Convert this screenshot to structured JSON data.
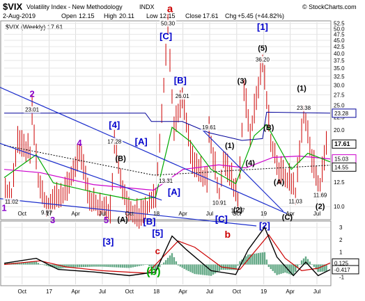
{
  "header": {
    "symbol": "$VIX",
    "name": "Volatility Index - New Methodology",
    "exchange": "INDX",
    "date": "2-Aug-2019",
    "open_label": "Open",
    "open": "12.15",
    "high_label": "High",
    "high": "20.11",
    "low_label": "Low",
    "low": "12.15",
    "close_label": "Close",
    "close": "17.61",
    "chg_label": "Chg",
    "chg": "+5.45 (+44.82%)",
    "copyright": "© StockCharts.com"
  },
  "legend_text": "$VIX (Weekly) 17.61",
  "colors": {
    "price_bar": "#cc0000",
    "trendline": "#1a2ccc",
    "upper_band": "#000099",
    "ma_short": "#00aa00",
    "ma_long": "#cc00cc",
    "dotted_line": "#000000",
    "wave_blue": "#0000cc",
    "wave_purple": "#8800cc",
    "wave_red": "#cc0000",
    "wave_green": "#00aa00",
    "hist": "#66aa88",
    "osc_black": "#000000",
    "osc_red": "#cc0000"
  },
  "chart_data": [
    {
      "type": "ohlc",
      "scale": "log",
      "ylim": [
        9,
        53
      ],
      "y_ticks": [
        "52.5",
        "50.0",
        "47.5",
        "45.0",
        "42.5",
        "40.0",
        "37.5",
        "35.0",
        "32.5",
        "30.0",
        "27.5",
        "25.0",
        "22.5",
        "20.0",
        "17.5",
        "15.0",
        "12.5",
        "10.0"
      ],
      "x_tick_labels": [
        "Oct",
        "17",
        "Apr",
        "Jul",
        "Oct",
        "18",
        "Apr",
        "Jul",
        "Oct",
        "19",
        "Apr",
        "Jul"
      ],
      "x_tick_dates": [
        "2016-10-01",
        "2017-01-01",
        "2017-04-01",
        "2017-07-01",
        "2017-10-01",
        "2018-01-01",
        "2018-04-01",
        "2018-07-01",
        "2018-10-01",
        "2019-01-01",
        "2019-04-01",
        "2019-07-01"
      ],
      "x_range": [
        "2016-08-01",
        "2019-08-15"
      ],
      "price_key_points": [
        {
          "date": "2016-08-05",
          "value": 11.5
        },
        {
          "date": "2016-08-26",
          "value": 11.02
        },
        {
          "date": "2016-09-16",
          "value": 18.0
        },
        {
          "date": "2016-10-28",
          "value": 16.0
        },
        {
          "date": "2016-11-04",
          "value": 23.01
        },
        {
          "date": "2016-11-25",
          "value": 12.5
        },
        {
          "date": "2016-12-23",
          "value": 9.97
        },
        {
          "date": "2017-03-03",
          "value": 11.5
        },
        {
          "date": "2017-04-14",
          "value": 16.0
        },
        {
          "date": "2017-05-19",
          "value": 10.5
        },
        {
          "date": "2017-07-28",
          "value": 9.4
        },
        {
          "date": "2017-08-11",
          "value": 17.28
        },
        {
          "date": "2017-09-22",
          "value": 9.8
        },
        {
          "date": "2017-11-03",
          "value": 9.1
        },
        {
          "date": "2017-12-29",
          "value": 10.8
        },
        {
          "date": "2018-02-09",
          "value": 50.3
        },
        {
          "date": "2018-03-02",
          "value": 19.6
        },
        {
          "date": "2018-03-30",
          "value": 26.01
        },
        {
          "date": "2018-05-04",
          "value": 14.5
        },
        {
          "date": "2018-06-22",
          "value": 12.5
        },
        {
          "date": "2018-06-29",
          "value": 19.61
        },
        {
          "date": "2018-08-03",
          "value": 10.91
        },
        {
          "date": "2018-08-17",
          "value": 15.0
        },
        {
          "date": "2018-09-28",
          "value": 11.5
        },
        {
          "date": "2018-10-05",
          "value": 10.17
        },
        {
          "date": "2018-10-26",
          "value": 28.0
        },
        {
          "date": "2018-11-16",
          "value": 19.0
        },
        {
          "date": "2018-12-28",
          "value": 36.2
        },
        {
          "date": "2019-01-25",
          "value": 18.0
        },
        {
          "date": "2019-02-22",
          "value": 13.5
        },
        {
          "date": "2019-04-12",
          "value": 12.0
        },
        {
          "date": "2019-04-19",
          "value": 11.03
        },
        {
          "date": "2019-05-17",
          "value": 23.38
        },
        {
          "date": "2019-06-14",
          "value": 15.0
        },
        {
          "date": "2019-07-12",
          "value": 11.69
        },
        {
          "date": "2019-08-02",
          "value": 17.61
        }
      ],
      "price_labels": [
        {
          "text": "11.02",
          "date": "2016-08-26",
          "value": 11.02,
          "pos": "below"
        },
        {
          "text": "23.01",
          "date": "2016-11-04",
          "value": 23.01,
          "pos": "above"
        },
        {
          "text": "9.97",
          "date": "2016-12-23",
          "value": 9.97,
          "pos": "below"
        },
        {
          "text": "17.28",
          "date": "2017-08-11",
          "value": 17.28,
          "pos": "above"
        },
        {
          "text": "50.30",
          "date": "2018-02-09",
          "value": 50.3,
          "pos": "above"
        },
        {
          "text": "26.01",
          "date": "2018-03-30",
          "value": 26.01,
          "pos": "above"
        },
        {
          "text": "13.31",
          "date": "2018-02-02",
          "value": 13.31,
          "pos": "below"
        },
        {
          "text": "19.61",
          "date": "2018-06-29",
          "value": 19.61,
          "pos": "above"
        },
        {
          "text": "10.91",
          "date": "2018-08-03",
          "value": 10.91,
          "pos": "below"
        },
        {
          "text": "10.17",
          "date": "2018-10-05",
          "value": 10.17,
          "pos": "below"
        },
        {
          "text": "36.20",
          "date": "2018-12-28",
          "value": 36.2,
          "pos": "above"
        },
        {
          "text": "23.38",
          "date": "2019-05-17",
          "value": 23.38,
          "pos": "above"
        },
        {
          "text": "11.03",
          "date": "2019-04-19",
          "value": 11.03,
          "pos": "below"
        },
        {
          "text": "11.69",
          "date": "2019-07-12",
          "value": 11.69,
          "pos": "below"
        }
      ],
      "right_value_tags": [
        {
          "text": "23.28",
          "value": 23.28,
          "color": "#000099"
        },
        {
          "text": "17.61",
          "value": 17.61,
          "color": "#000000",
          "bold": true
        },
        {
          "text": "15.03",
          "value": 15.4,
          "color": "#cc00cc"
        },
        {
          "text": "14.55",
          "value": 14.3,
          "color": "#000000"
        }
      ],
      "upper_band": [
        {
          "date": "2016-08-01",
          "value": 23.3
        },
        {
          "date": "2017-11-24",
          "value": 23.3
        },
        {
          "date": "2017-12-15",
          "value": 21.6
        },
        {
          "date": "2018-03-30",
          "value": 21.6
        },
        {
          "date": "2018-06-29",
          "value": 19.5
        },
        {
          "date": "2018-10-19",
          "value": 18.2
        },
        {
          "date": "2018-12-28",
          "value": 18.5
        },
        {
          "date": "2019-01-11",
          "value": 23.5
        },
        {
          "date": "2019-08-15",
          "value": 23.28
        }
      ],
      "ma_long": [
        {
          "date": "2016-08-01",
          "value": 14.0
        },
        {
          "date": "2016-12-01",
          "value": 13.6
        },
        {
          "date": "2017-06-01",
          "value": 12.2
        },
        {
          "date": "2017-12-22",
          "value": 11.6
        },
        {
          "date": "2018-04-01",
          "value": 14.0
        },
        {
          "date": "2018-08-01",
          "value": 14.6
        },
        {
          "date": "2018-11-01",
          "value": 14.2
        },
        {
          "date": "2019-02-01",
          "value": 15.6
        },
        {
          "date": "2019-05-01",
          "value": 15.8
        },
        {
          "date": "2019-08-15",
          "value": 15.4
        }
      ],
      "ma_short": [
        {
          "date": "2016-08-01",
          "value": 13.0
        },
        {
          "date": "2016-11-18",
          "value": 16.0
        },
        {
          "date": "2017-01-15",
          "value": 12.4
        },
        {
          "date": "2017-06-01",
          "value": 11.4
        },
        {
          "date": "2017-10-20",
          "value": 10.6
        },
        {
          "date": "2017-12-29",
          "value": 10.9
        },
        {
          "date": "2018-02-23",
          "value": 20.5
        },
        {
          "date": "2018-04-27",
          "value": 18.0
        },
        {
          "date": "2018-07-06",
          "value": 14.0
        },
        {
          "date": "2018-09-28",
          "value": 12.3
        },
        {
          "date": "2018-11-30",
          "value": 19.0
        },
        {
          "date": "2019-01-11",
          "value": 21.0
        },
        {
          "date": "2019-04-05",
          "value": 14.0
        },
        {
          "date": "2019-05-31",
          "value": 16.2
        },
        {
          "date": "2019-08-15",
          "value": 15.0
        }
      ],
      "dotted_line": [
        {
          "date": "2016-08-01",
          "value": 17.4
        },
        {
          "date": "2017-12-22",
          "value": 13.3
        },
        {
          "date": "2018-06-01",
          "value": 13.6
        },
        {
          "date": "2018-10-01",
          "value": 13.9
        },
        {
          "date": "2019-08-15",
          "value": 14.55
        }
      ],
      "trendlines": [
        {
          "from": {
            "date": "2016-07-01",
            "value": 30.0
          },
          "to": {
            "date": "2019-03-20",
            "value": 9.4
          }
        },
        {
          "from": {
            "date": "2016-07-01",
            "value": 18.0
          },
          "to": {
            "date": "2018-01-19",
            "value": 10.6
          }
        },
        {
          "from": {
            "date": "2018-06-01",
            "value": 20.3
          },
          "to": {
            "date": "2019-03-08",
            "value": 9.6
          }
        },
        {
          "from": {
            "date": "2016-07-01",
            "value": 10.8
          },
          "to": {
            "date": "2018-12-07",
            "value": 8.4
          }
        }
      ],
      "wave_labels": [
        {
          "text": "a",
          "date": "2018-02-16",
          "value": 58.0,
          "color": "#cc0000",
          "size": 15
        },
        {
          "text": "[C]",
          "date": "2018-02-02",
          "value": 45.5,
          "color": "#0000cc",
          "size": 13
        },
        {
          "text": "[1]",
          "date": "2018-12-28",
          "value": 49.5,
          "color": "#0000cc",
          "size": 13
        },
        {
          "text": "(5)",
          "date": "2018-12-28",
          "value": 41.0,
          "color": "#000000",
          "size": 11
        },
        {
          "text": "(3)",
          "date": "2018-10-19",
          "value": 30.5,
          "color": "#000000",
          "size": 11
        },
        {
          "text": "(1)",
          "date": "2019-05-10",
          "value": 28.5,
          "color": "#000000",
          "size": 11
        },
        {
          "text": "[B]",
          "date": "2018-03-23",
          "value": 30.5,
          "color": "#0000cc",
          "size": 13
        },
        {
          "text": "2",
          "date": "2016-11-04",
          "value": 27.0,
          "color": "#8800cc",
          "size": 13
        },
        {
          "text": "[4]",
          "date": "2017-08-11",
          "value": 20.4,
          "color": "#0000cc",
          "size": 13
        },
        {
          "text": "[A]",
          "date": "2017-11-10",
          "value": 17.5,
          "color": "#0000cc",
          "size": 13
        },
        {
          "text": "4",
          "date": "2017-04-14",
          "value": 17.3,
          "color": "#8800cc",
          "size": 13
        },
        {
          "text": "(B)",
          "date": "2017-09-01",
          "value": 15.1,
          "color": "#000000",
          "size": 11
        },
        {
          "text": "(1)",
          "date": "2018-09-07",
          "value": 17.0,
          "color": "#000000",
          "size": 11
        },
        {
          "text": "(B)",
          "date": "2019-01-18",
          "value": 20.0,
          "color": "#000000",
          "size": 11
        },
        {
          "text": "(4)",
          "date": "2018-11-16",
          "value": 14.5,
          "color": "#000000",
          "size": 11
        },
        {
          "text": "(A)",
          "date": "2019-02-22",
          "value": 12.2,
          "color": "#000000",
          "size": 11
        },
        {
          "text": "[A]",
          "date": "2018-03-02",
          "value": 11.1,
          "color": "#0000cc",
          "size": 13
        },
        {
          "text": "(2)",
          "date": "2018-10-05",
          "value": 9.5,
          "color": "#000000",
          "size": 11
        },
        {
          "text": "(C)",
          "date": "2019-03-22",
          "value": 8.9,
          "color": "#000000",
          "size": 11
        },
        {
          "text": "(2)",
          "date": "2019-07-12",
          "value": 9.8,
          "color": "#000000",
          "size": 11
        },
        {
          "text": "[C]",
          "date": "2018-08-10",
          "value": 8.7,
          "color": "#0000cc",
          "size": 13
        },
        {
          "text": "[2]",
          "date": "2019-01-04",
          "value": 8.2,
          "color": "#0000cc",
          "size": 13
        },
        {
          "text": "1",
          "date": "2016-08-01",
          "value": 9.6,
          "color": "#8800cc",
          "size": 13
        },
        {
          "text": "3",
          "date": "2017-01-13",
          "value": 8.6,
          "color": "#8800cc",
          "size": 13
        },
        {
          "text": "5",
          "date": "2017-07-14",
          "value": 8.6,
          "color": "#8800cc",
          "size": 13
        },
        {
          "text": "(A)",
          "date": "2017-09-08",
          "value": 8.7,
          "color": "#000000",
          "size": 11
        },
        {
          "text": "[B]",
          "date": "2017-12-08",
          "value": 8.5,
          "color": "#0000cc",
          "size": 13
        },
        {
          "text": "b",
          "date": "2018-08-31",
          "value": 7.55,
          "color": "#cc0000",
          "size": 14
        }
      ]
    },
    {
      "type": "oscillator",
      "ylim": [
        -1.6,
        3.4
      ],
      "y_ticks": [
        "3",
        "2",
        "1",
        "0",
        "-1"
      ],
      "right_value_tags": [
        {
          "text": "0.125",
          "value": 0.125,
          "color": "#000000"
        },
        {
          "text": "-0.417",
          "value": -0.417,
          "color": "#000000"
        }
      ],
      "line_black": [
        {
          "date": "2016-08-01",
          "value": 0.1
        },
        {
          "date": "2016-11-18",
          "value": 0.5
        },
        {
          "date": "2017-02-01",
          "value": -0.4
        },
        {
          "date": "2017-06-01",
          "value": -0.6
        },
        {
          "date": "2017-10-01",
          "value": -0.9
        },
        {
          "date": "2017-12-29",
          "value": -0.6
        },
        {
          "date": "2018-02-23",
          "value": 2.3
        },
        {
          "date": "2018-04-13",
          "value": 1.2
        },
        {
          "date": "2018-07-06",
          "value": -0.5
        },
        {
          "date": "2018-09-28",
          "value": -0.8
        },
        {
          "date": "2018-11-09",
          "value": 1.2
        },
        {
          "date": "2019-01-04",
          "value": 3.0
        },
        {
          "date": "2019-02-15",
          "value": 0.6
        },
        {
          "date": "2019-04-12",
          "value": -0.9
        },
        {
          "date": "2019-05-24",
          "value": 0.2
        },
        {
          "date": "2019-07-05",
          "value": -0.9
        },
        {
          "date": "2019-08-15",
          "value": -0.417
        }
      ],
      "line_red": [
        {
          "date": "2016-08-01",
          "value": 0.0
        },
        {
          "date": "2016-12-02",
          "value": 0.3
        },
        {
          "date": "2017-03-01",
          "value": -0.2
        },
        {
          "date": "2017-07-01",
          "value": -0.5
        },
        {
          "date": "2017-12-01",
          "value": -0.7
        },
        {
          "date": "2018-03-16",
          "value": 1.9
        },
        {
          "date": "2018-05-11",
          "value": 1.4
        },
        {
          "date": "2018-08-10",
          "value": -0.2
        },
        {
          "date": "2018-10-12",
          "value": -0.4
        },
        {
          "date": "2019-01-18",
          "value": 2.4
        },
        {
          "date": "2019-03-15",
          "value": 0.5
        },
        {
          "date": "2019-05-10",
          "value": -0.5
        },
        {
          "date": "2019-07-05",
          "value": -0.3
        },
        {
          "date": "2019-08-15",
          "value": 0.125
        }
      ],
      "wave_labels": [
        {
          "text": "[5]",
          "date": "2018-01-05",
          "value": 2.3,
          "color": "#0000cc",
          "size": 13
        },
        {
          "text": "[3]",
          "date": "2017-07-21",
          "value": 1.6,
          "color": "#0000cc",
          "size": 13
        },
        {
          "text": "c",
          "date": "2018-01-05",
          "value": 0.85,
          "color": "#cc0000",
          "size": 13
        },
        {
          "text": "(b)",
          "date": "2017-12-22",
          "value": -0.85,
          "color": "#00aa00",
          "size": 16
        }
      ]
    }
  ]
}
